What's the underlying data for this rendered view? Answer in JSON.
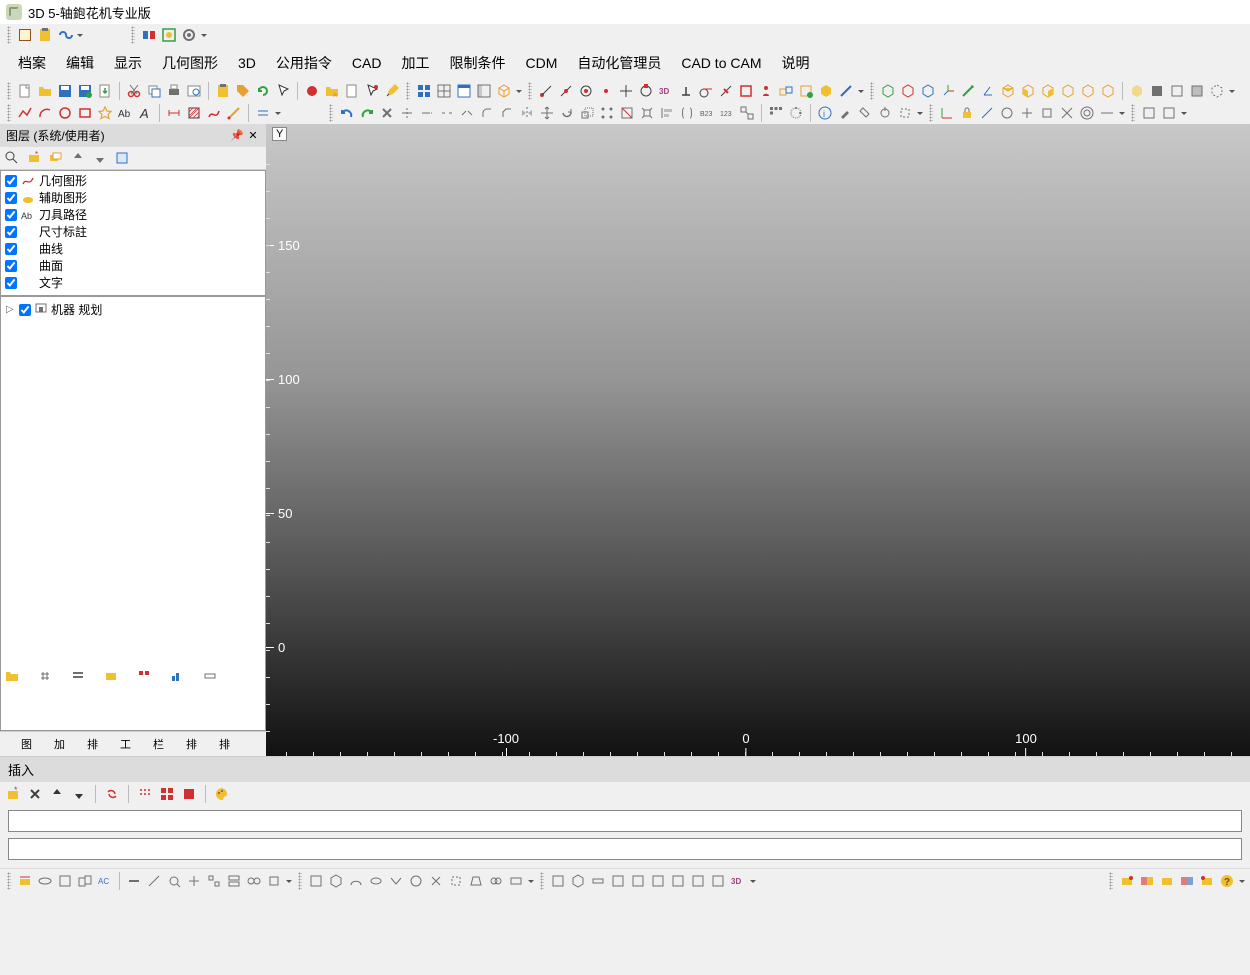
{
  "title": "3D 5-轴鉋花机专业版",
  "menu": [
    "档案",
    "编辑",
    "显示",
    "几何图形",
    "3D",
    "公用指令",
    "CAD",
    "加工",
    "限制条件",
    "CDM",
    "自动化管理员",
    "CAD to CAM",
    "说明"
  ],
  "panel": {
    "title": "图层 (系统/使用者)"
  },
  "layers": [
    {
      "label": "几何图形",
      "icon": "geom"
    },
    {
      "label": "辅助图形",
      "icon": "aux"
    },
    {
      "label": "刀具路径",
      "icon": "tool"
    },
    {
      "label": "尺寸标註",
      "icon": "dim"
    },
    {
      "label": "曲线",
      "icon": "curve"
    },
    {
      "label": "曲面",
      "icon": "surf"
    },
    {
      "label": "文字",
      "icon": "text"
    }
  ],
  "tree": {
    "item": "机器 规划"
  },
  "sidetabs": [
    "图",
    "加",
    "排",
    "工",
    "栏",
    "排",
    "排"
  ],
  "insert": {
    "title": "插入"
  },
  "viewport": {
    "axis": "Y",
    "yTicks": [
      {
        "v": "150",
        "p": 114
      },
      {
        "v": "100",
        "p": 248
      },
      {
        "v": "50",
        "p": 382
      },
      {
        "v": "0",
        "p": 516
      }
    ],
    "xTicks": [
      {
        "v": "-100",
        "p": 240
      },
      {
        "v": "0",
        "p": 480
      },
      {
        "v": "100",
        "p": 760
      }
    ]
  }
}
